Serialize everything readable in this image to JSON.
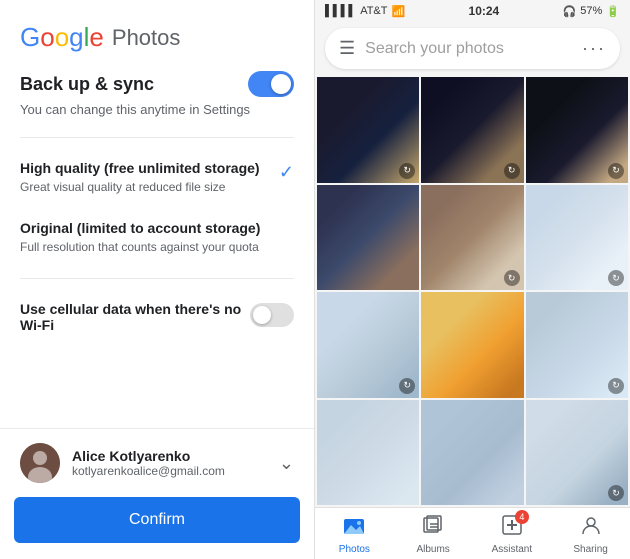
{
  "left": {
    "logo": {
      "letters": [
        "G",
        "o",
        "o",
        "g",
        "l",
        "e"
      ],
      "photos_text": "Photos"
    },
    "backup": {
      "title": "Back up & sync",
      "subtitle": "You can change this anytime in Settings",
      "toggle_on": true
    },
    "high_quality": {
      "title": "High quality (free unlimited storage)",
      "subtitle": "Great visual quality at reduced file size",
      "selected": true
    },
    "original": {
      "title": "Original (limited to account storage)",
      "subtitle": "Full resolution that counts against your quota",
      "selected": false
    },
    "cellular": {
      "title": "Use cellular data when there's no Wi-Fi",
      "toggle_on": false
    },
    "account": {
      "name": "Alice Kotlyarenko",
      "email": "kotlyarenkoalice@gmail.com"
    },
    "confirm_label": "Confirm"
  },
  "right": {
    "status_bar": {
      "carrier": "AT&T",
      "time": "10:24",
      "battery": "57%"
    },
    "search": {
      "placeholder": "Search your photos"
    },
    "photos": [
      {
        "id": 1,
        "has_sync": true
      },
      {
        "id": 2,
        "has_sync": true
      },
      {
        "id": 3,
        "has_sync": true
      },
      {
        "id": 4,
        "has_sync": false
      },
      {
        "id": 5,
        "has_sync": true
      },
      {
        "id": 6,
        "has_sync": true
      },
      {
        "id": 7,
        "has_sync": true
      },
      {
        "id": 8,
        "has_sync": false
      },
      {
        "id": 9,
        "has_sync": true
      },
      {
        "id": 10,
        "has_sync": false
      },
      {
        "id": 11,
        "has_sync": false
      },
      {
        "id": 12,
        "has_sync": true
      }
    ],
    "nav": [
      {
        "label": "Photos",
        "icon": "🏔",
        "active": true,
        "badge": 0
      },
      {
        "label": "Albums",
        "icon": "📋",
        "active": false,
        "badge": 0
      },
      {
        "label": "Assistant",
        "icon": "✚",
        "active": false,
        "badge": 4
      },
      {
        "label": "Sharing",
        "icon": "👤",
        "active": false,
        "badge": 0
      }
    ]
  }
}
